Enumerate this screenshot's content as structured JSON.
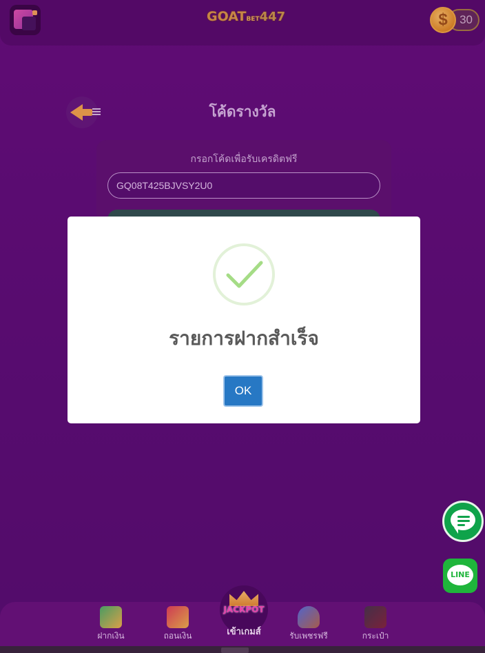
{
  "header": {
    "logo_main": "GOAT",
    "logo_bet": "BET",
    "logo_num": "447",
    "coin_icon": "dollar-coin-icon",
    "coin_symbol": "$",
    "credit_balance": "30"
  },
  "page": {
    "title": "โค้ดรางวัล",
    "back_icon": "back-arrow-icon"
  },
  "redeem_card": {
    "label": "กรอกโค้ดเพื่อรับเครดิตฟรี",
    "code_value": "GQ08T425BJVSY2U0"
  },
  "modal": {
    "icon": "check-icon",
    "title": "รายการฝากสำเร็จ",
    "ok_label": "OK"
  },
  "floating": {
    "chat_icon": "chat-bubble-icon",
    "line_label": "LINE"
  },
  "bottom_nav": {
    "items": [
      {
        "label": "ฝากเงิน",
        "icon": "deposit-icon"
      },
      {
        "label": "ถอนเงิน",
        "icon": "withdraw-icon"
      },
      {
        "label": "เข้าเกมส์",
        "icon": "jackpot-icon",
        "badge": "JACKPOT"
      },
      {
        "label": "รับเพชรฟรี",
        "icon": "diamond-bag-icon"
      },
      {
        "label": "กระเป๋า",
        "icon": "wallet-icon"
      }
    ]
  },
  "colors": {
    "background": "#520f6b",
    "accent_gold": "#f3b33a",
    "ok_button": "#2778c4",
    "success_check": "#a5dc86",
    "line_green": "#1fb53b"
  }
}
